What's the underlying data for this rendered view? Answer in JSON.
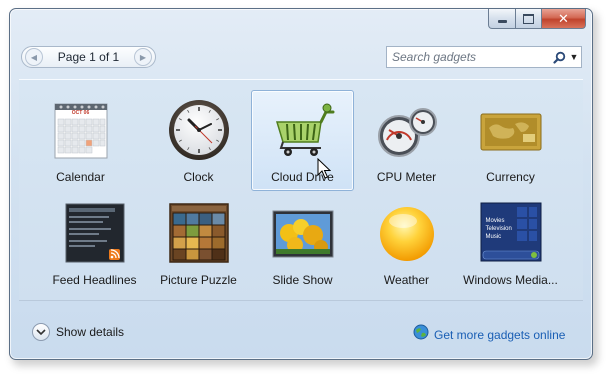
{
  "pager": {
    "label": "Page 1 of 1",
    "prev_icon": "chevron-left-icon",
    "next_icon": "chevron-right-icon"
  },
  "search": {
    "placeholder": "Search gadgets",
    "icon": "search-icon",
    "dropdown_icon": "chevron-down-icon"
  },
  "gadgets": [
    {
      "name": "Calendar",
      "icon": "calendar-icon",
      "calendar_month": "OCT 06"
    },
    {
      "name": "Clock",
      "icon": "clock-icon"
    },
    {
      "name": "Cloud Drive",
      "icon": "shopping-cart-icon",
      "selected": true
    },
    {
      "name": "CPU Meter",
      "icon": "gauge-icon"
    },
    {
      "name": "Currency",
      "icon": "currency-icon"
    },
    {
      "name": "Feed Headlines",
      "icon": "rss-feed-icon"
    },
    {
      "name": "Picture Puzzle",
      "icon": "puzzle-icon"
    },
    {
      "name": "Slide Show",
      "icon": "slideshow-icon"
    },
    {
      "name": "Weather",
      "icon": "sun-icon"
    },
    {
      "name": "Windows Media...",
      "icon": "media-center-icon",
      "menu": [
        "Movies",
        "Television",
        "Music"
      ]
    }
  ],
  "footer": {
    "details_label": "Show details",
    "details_icon": "chevron-down-circle-icon",
    "link_label": "Get more gadgets online",
    "link_icon": "globe-icon"
  },
  "colors": {
    "accent": "#1a5fb4",
    "selection_border": "#8fb2d8",
    "window_border": "#5b6f86",
    "close_button": "#c0432c"
  }
}
